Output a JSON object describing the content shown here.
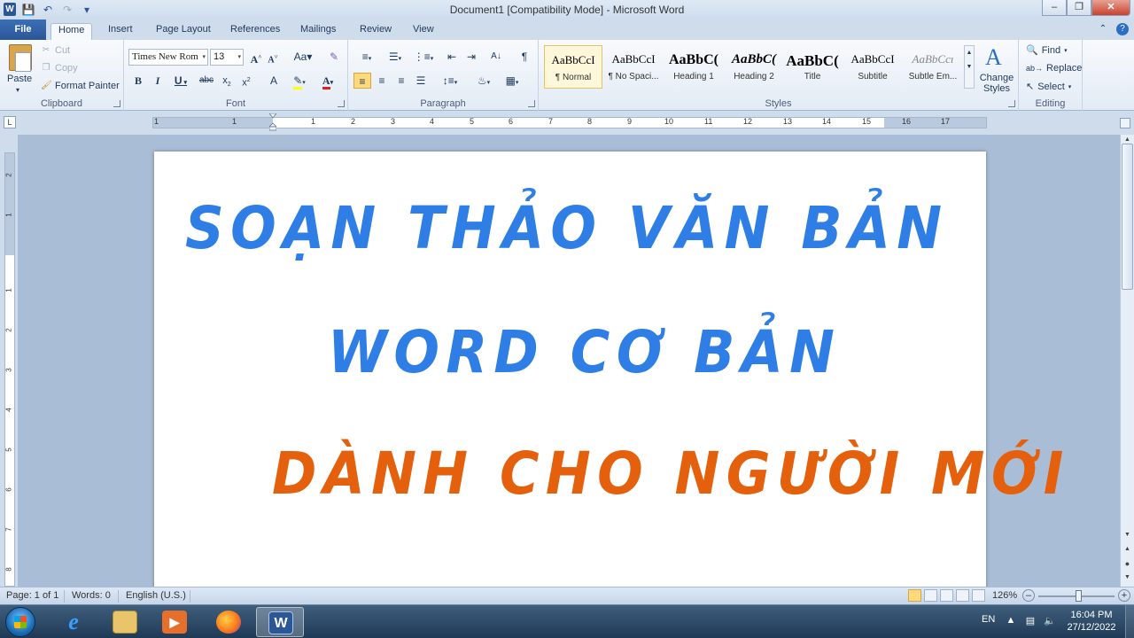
{
  "window": {
    "title": "Document1 [Compatibility Mode]  -  Microsoft Word",
    "app_icon": "W"
  },
  "tabs": {
    "file": "File",
    "items": [
      "Home",
      "Insert",
      "Page Layout",
      "References",
      "Mailings",
      "Review",
      "View"
    ],
    "active": "Home"
  },
  "clipboard": {
    "paste": "Paste",
    "cut": "Cut",
    "copy": "Copy",
    "format_painter": "Format Painter",
    "label": "Clipboard"
  },
  "font": {
    "name": "Times New Rom",
    "size": "13",
    "label": "Font"
  },
  "paragraph": {
    "label": "Paragraph"
  },
  "styles": {
    "items": [
      {
        "sample": "AaBbCcI",
        "name": "¶ Normal"
      },
      {
        "sample": "AaBbCcI",
        "name": "¶ No Spaci..."
      },
      {
        "sample": "AaBbC(",
        "name": "Heading 1"
      },
      {
        "sample": "AaBbC(",
        "name": "Heading 2"
      },
      {
        "sample": "AaBbC(",
        "name": "Title"
      },
      {
        "sample": "AaBbCcI",
        "name": "Subtitle"
      },
      {
        "sample": "AaBbCcı",
        "name": "Subtle Em..."
      }
    ],
    "change_styles": "Change Styles",
    "label": "Styles"
  },
  "editing": {
    "find": "Find",
    "replace": "Replace",
    "select": "Select",
    "label": "Editing"
  },
  "document": {
    "line1": "SOẠN THẢO VĂN BẢN",
    "line2": "WORD CƠ BẢN",
    "line3": "DÀNH CHO NGƯỜI MỚI",
    "colors": {
      "blue": "#2e7ee6",
      "orange": "#e4600d"
    }
  },
  "status": {
    "page": "Page: 1 of 1",
    "words": "Words: 0",
    "language": "English (U.S.)",
    "zoom": "126%"
  },
  "taskbar": {
    "apps": [
      "internet-explorer",
      "file-explorer",
      "media-player",
      "firefox",
      "word"
    ],
    "language": "EN",
    "time": "16:04 PM",
    "date": "27/12/2022"
  }
}
